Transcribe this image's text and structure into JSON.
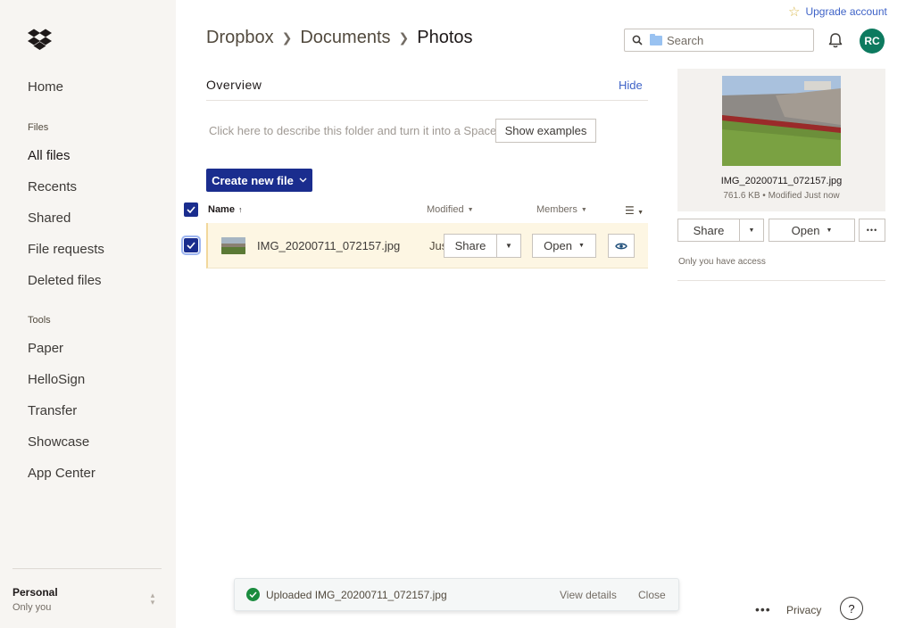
{
  "sidebar": {
    "primary": [
      {
        "label": "Home"
      }
    ],
    "files_section": "Files",
    "files_items": [
      {
        "label": "All files"
      },
      {
        "label": "Recents"
      },
      {
        "label": "Shared"
      },
      {
        "label": "File requests"
      },
      {
        "label": "Deleted files"
      }
    ],
    "tools_section": "Tools",
    "tools_items": [
      {
        "label": "Paper"
      },
      {
        "label": "HelloSign"
      },
      {
        "label": "Transfer"
      },
      {
        "label": "Showcase"
      },
      {
        "label": "App Center"
      }
    ],
    "account": {
      "name": "Personal",
      "sub": "Only you"
    }
  },
  "header": {
    "upgrade_label": "Upgrade account",
    "breadcrumb": [
      "Dropbox",
      "Documents",
      "Photos"
    ],
    "search_placeholder": "Search",
    "avatar_initials": "RC"
  },
  "overview": {
    "title": "Overview",
    "hide_label": "Hide",
    "describe_text": "Click here to describe this folder and turn it into a Space",
    "show_examples_label": "Show examples"
  },
  "create_label": "Create new file",
  "table": {
    "headers": {
      "name": "Name",
      "modified": "Modified",
      "members": "Members"
    },
    "rows": [
      {
        "name": "IMG_20200711_072157.jpg",
        "modified": "Just now",
        "share_label": "Share",
        "open_label": "Open"
      }
    ]
  },
  "preview": {
    "filename": "IMG_20200711_072157.jpg",
    "meta": "761.6 KB • Modified Just now",
    "share_label": "Share",
    "open_label": "Open",
    "more_label": "•••",
    "access_text": "Only you have access"
  },
  "toast": {
    "message": "Uploaded IMG_20200711_072157.jpg",
    "view_label": "View details",
    "close_label": "Close"
  },
  "footer": {
    "more_label": "•••",
    "privacy_label": "Privacy",
    "help_label": "?"
  },
  "colors": {
    "accent": "#1a2d8e",
    "link": "#3f63c7",
    "avatar": "#0d7a5f",
    "success": "#1a8c3e",
    "sidebar_bg": "#f7f5f2",
    "selected_row": "#fdf6e3"
  }
}
